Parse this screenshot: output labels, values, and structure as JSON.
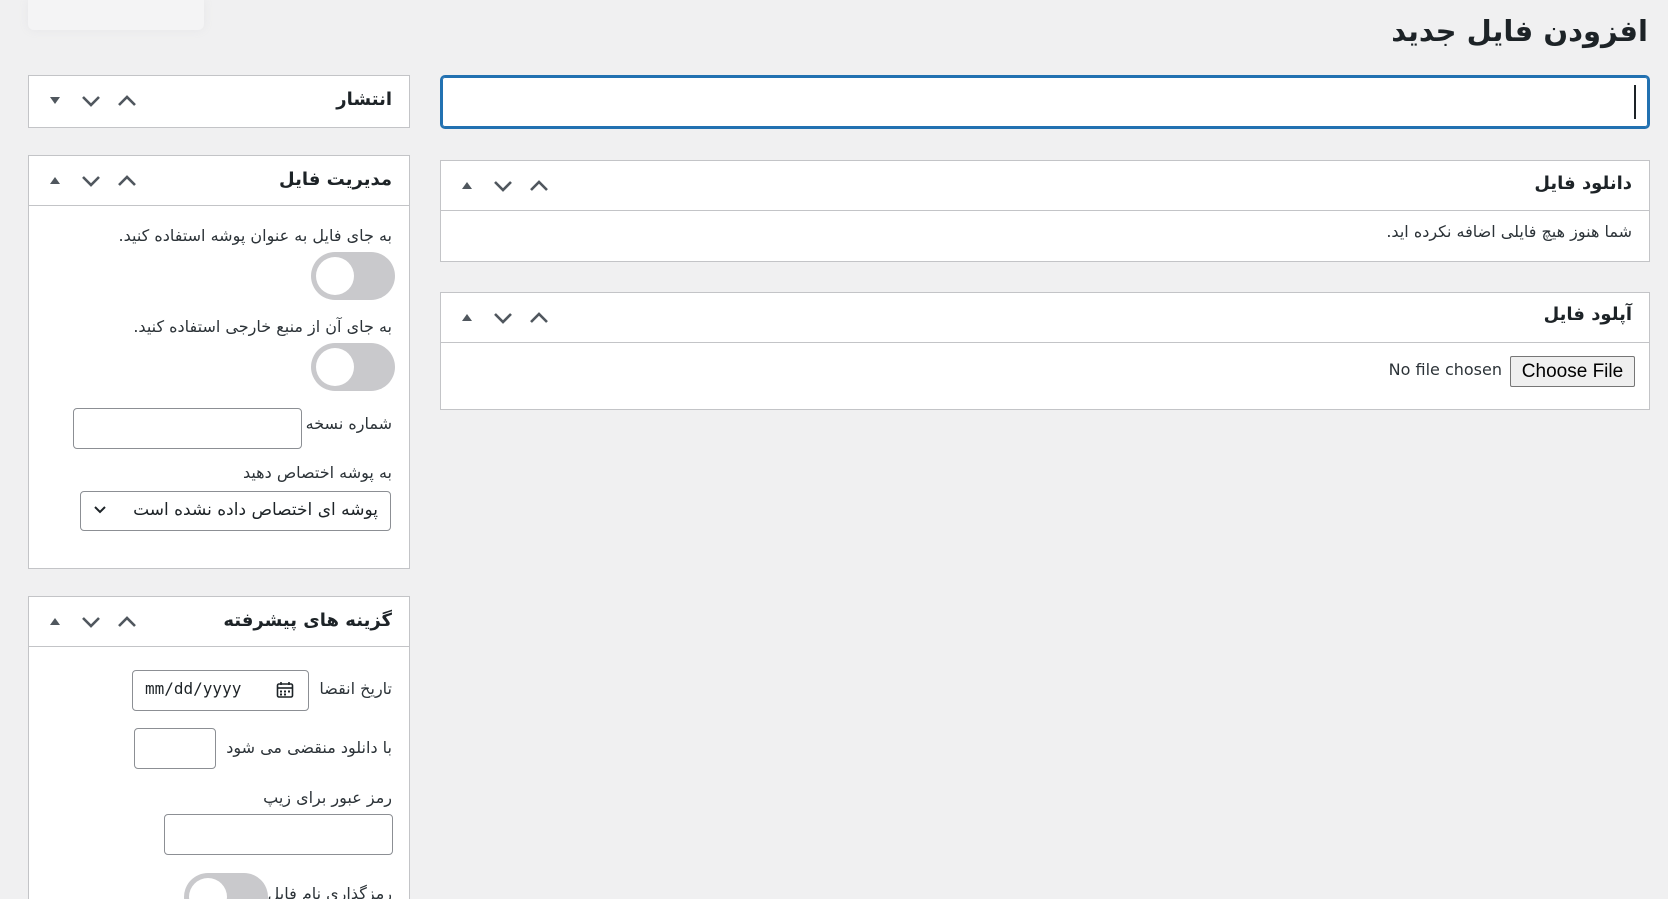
{
  "page": {
    "title": "افزودن فایل جدید"
  },
  "title_input": {
    "value": "",
    "placeholder": ""
  },
  "boxes": {
    "publish": {
      "title": "انتشار"
    },
    "download": {
      "title": "دانلود فایل",
      "empty_message": "شما هنوز هیچ فایلی اضافه نکرده اید."
    },
    "upload": {
      "title": "آپلود فایل",
      "choose_label": "Choose File",
      "no_file_label": "No file chosen"
    },
    "file_management": {
      "title": "مدیریت فایل",
      "use_folder_label": "به جای فایل به عنوان پوشه استفاده کنید.",
      "use_folder_on": false,
      "external_source_label": "به جای آن از منبع خارجی استفاده کنید.",
      "external_source_on": false,
      "version_label": "شماره نسخه",
      "version_value": "",
      "assign_folder_label": "به پوشه اختصاص دهید",
      "assign_folder_selected": "پوشه ای اختصاص داده نشده است"
    },
    "advanced": {
      "title": "گزینه های پیشرفته",
      "expiry_label": "تاریخ انقضا",
      "expiry_placeholder": "mm/dd/yyyy",
      "expire_on_download_label": "با دانلود منقضی می شود",
      "expire_on_download_value": "",
      "zip_password_label": "رمز عبور برای زیپ",
      "zip_password_value": "",
      "file_name_label": "رمزگذاری نام فایل",
      "file_name_on": false
    }
  },
  "icons": {
    "move_up": "chevron-up-icon",
    "move_down": "chevron-down-icon",
    "toggle_panel": "triangle-toggle-icon",
    "calendar": "calendar-icon",
    "select_arrow": "chevron-down-icon"
  },
  "colors": {
    "background": "#f0f0f1",
    "accent": "#2271b1",
    "border": "#c3c4c7",
    "toggle_off": "#c9c9cc"
  }
}
